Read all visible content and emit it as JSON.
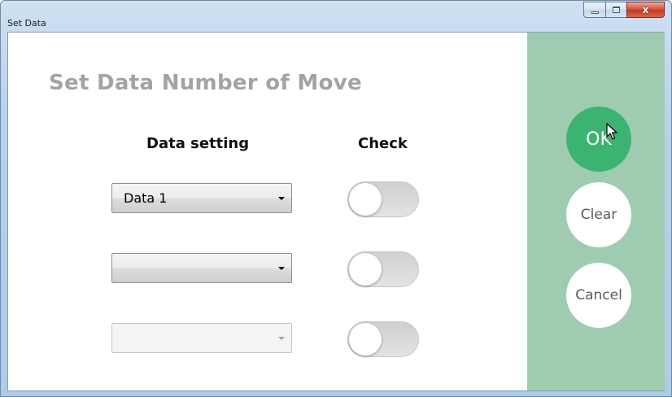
{
  "window": {
    "title": "Set Data",
    "controls": {
      "minimize_icon": "minimize-icon",
      "maximize_icon": "maximize-icon",
      "close_icon": "close-icon",
      "close_glyph": "x"
    }
  },
  "form": {
    "heading": "Set Data Number of Move",
    "column_data": "Data setting",
    "column_check": "Check",
    "rows": [
      {
        "selected_value": "Data  1",
        "enabled": true,
        "toggle_on": false
      },
      {
        "selected_value": "",
        "enabled": true,
        "toggle_on": false
      },
      {
        "selected_value": "",
        "enabled": false,
        "toggle_on": false
      }
    ]
  },
  "actions": {
    "ok_label": "OK",
    "clear_label": "Clear",
    "cancel_label": "Cancel"
  },
  "colors": {
    "side_panel": "#9fccb0",
    "ok_button": "#3cb371",
    "heading_text": "#a3a3a3"
  }
}
